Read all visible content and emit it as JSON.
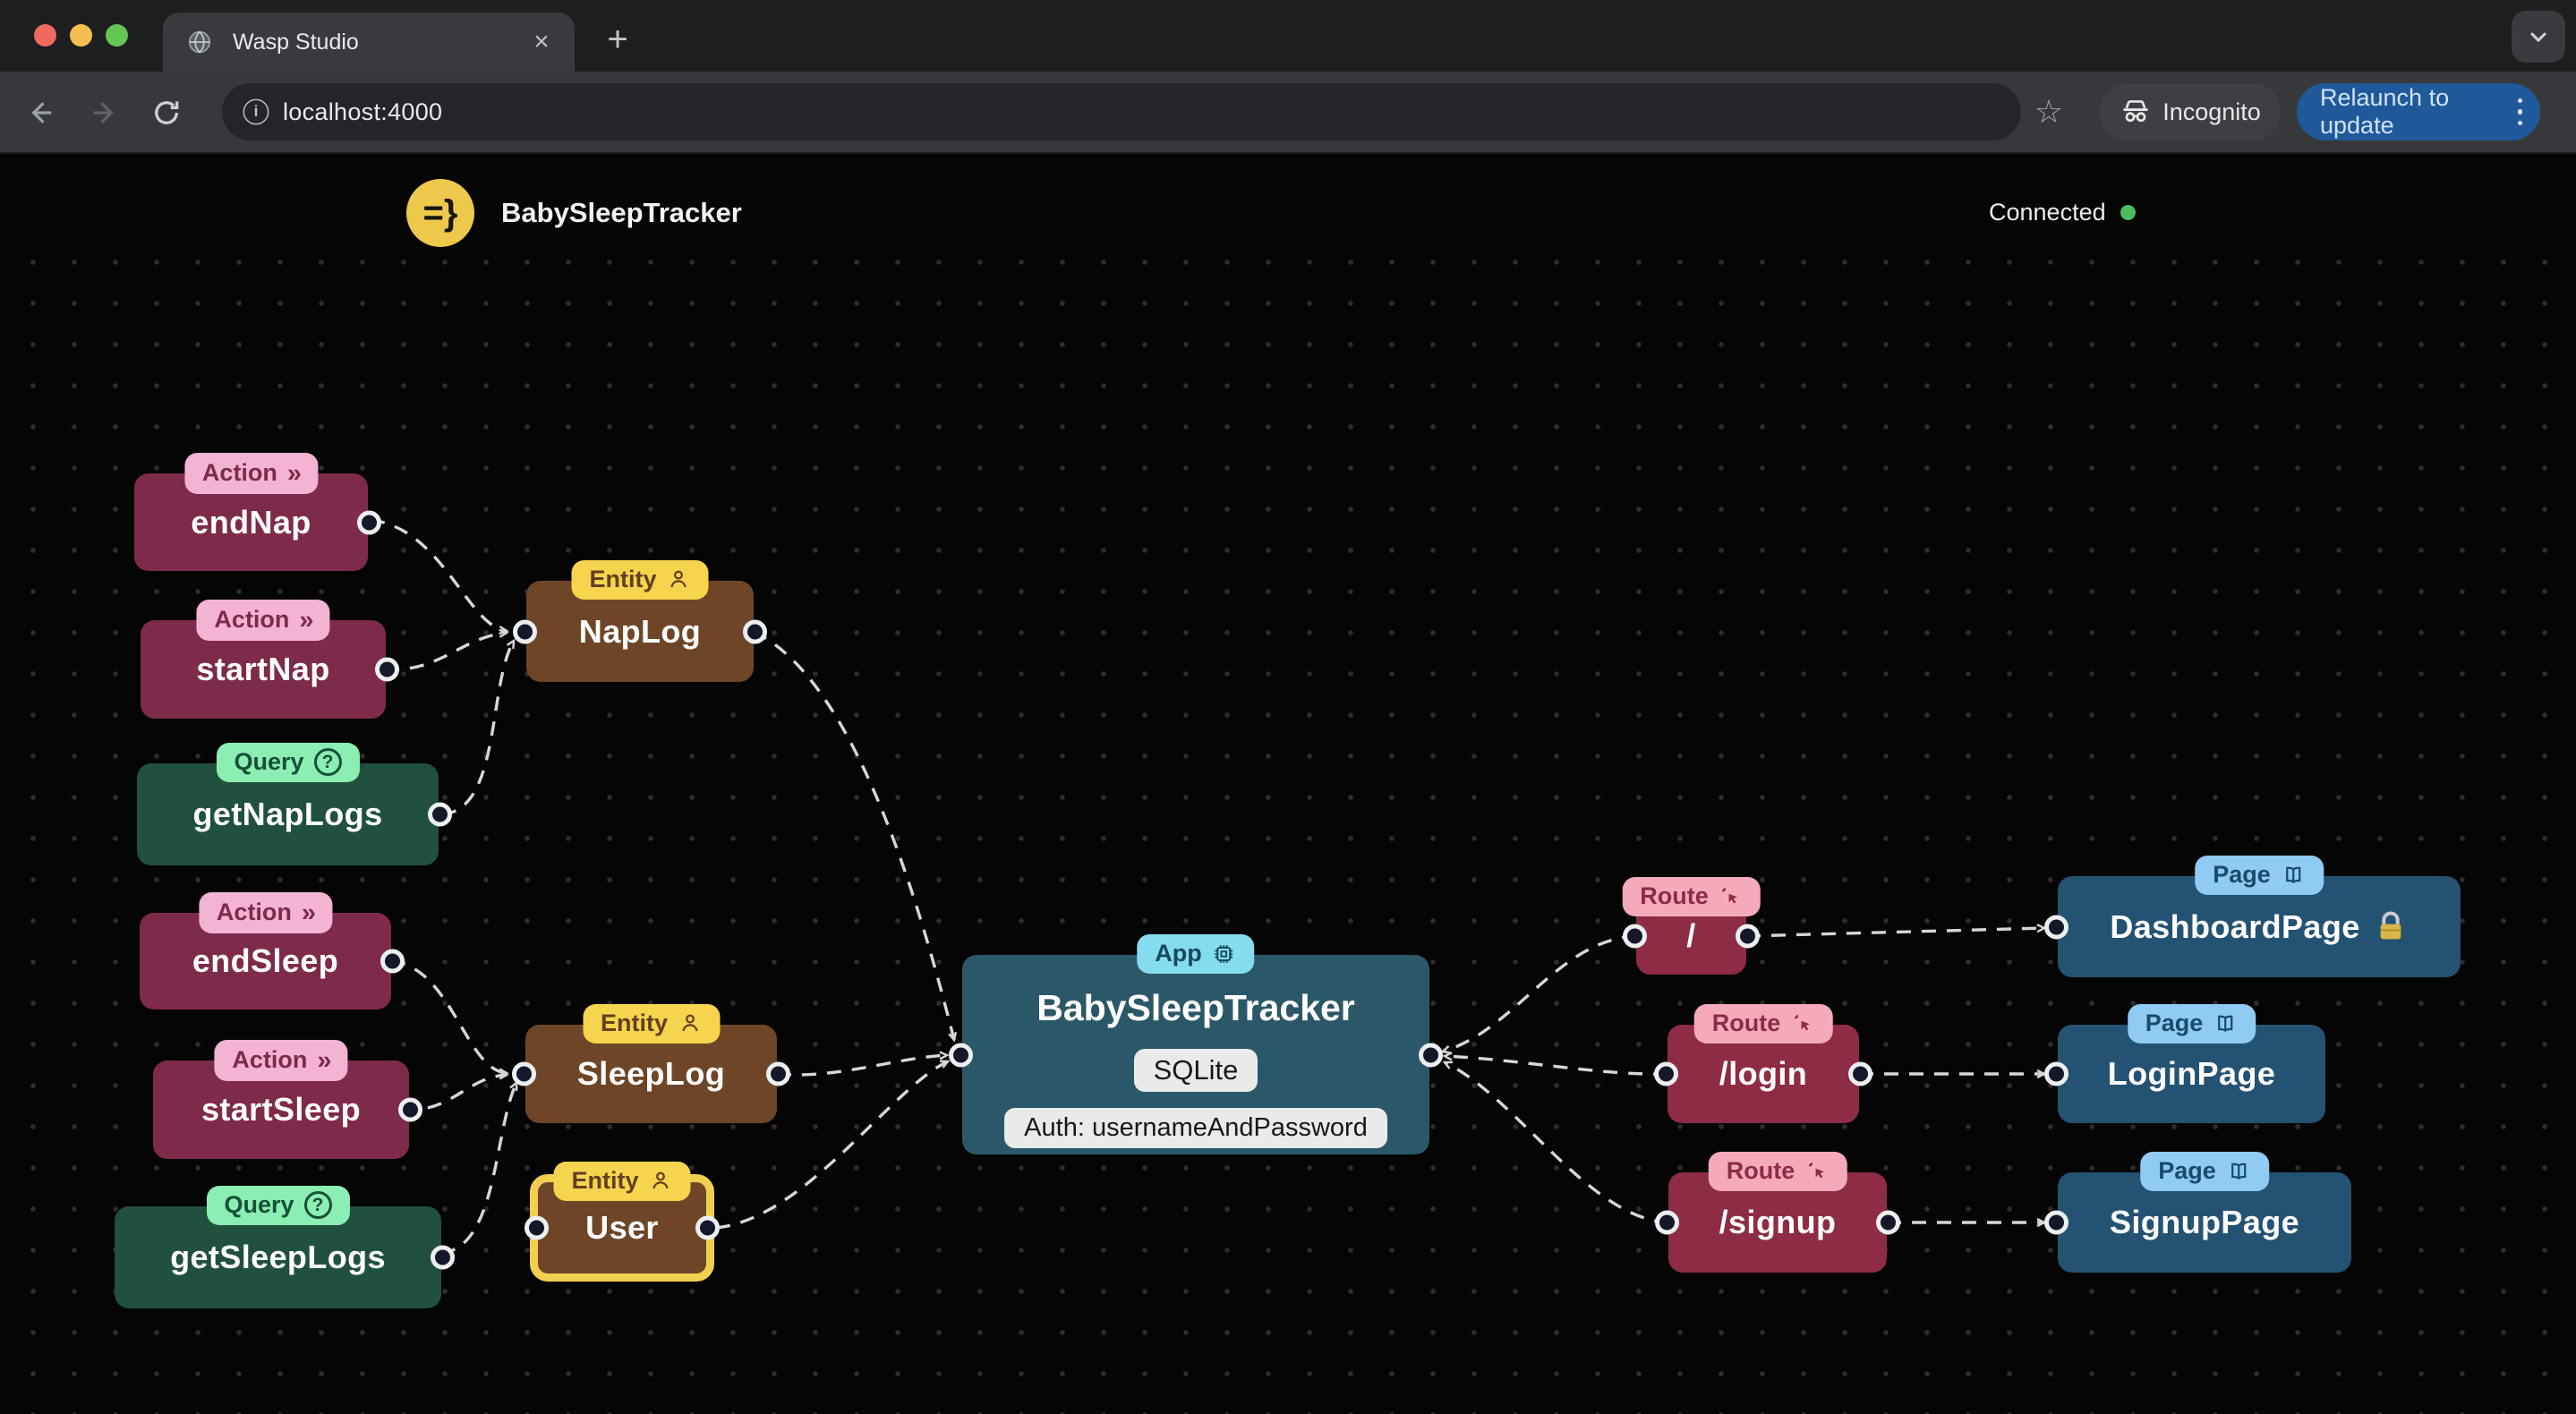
{
  "browser": {
    "tab_title": "Wasp Studio",
    "url": "localhost:4000",
    "incognito_label": "Incognito",
    "relaunch_label": "Relaunch to update"
  },
  "header": {
    "app_title": "BabySleepTracker",
    "status_label": "Connected",
    "logo_glyph": "=}"
  },
  "badges": {
    "action": "Action",
    "query": "Query",
    "entity": "Entity",
    "app": "App",
    "route": "Route",
    "page": "Page"
  },
  "icons": {
    "action_chevrons": "»",
    "query_question": "?",
    "new_tab": "+",
    "close_tab": "×",
    "bookmark_star": "☆",
    "url_info": "i"
  },
  "nodes": {
    "endNap": {
      "label": "endNap"
    },
    "startNap": {
      "label": "startNap"
    },
    "getNapLogs": {
      "label": "getNapLogs"
    },
    "endSleep": {
      "label": "endSleep"
    },
    "startSleep": {
      "label": "startSleep"
    },
    "getSleepLogs": {
      "label": "getSleepLogs"
    },
    "napLog": {
      "label": "NapLog"
    },
    "sleepLog": {
      "label": "SleepLog"
    },
    "user": {
      "label": "User"
    },
    "app": {
      "label": "BabySleepTracker",
      "db_label": "SQLite",
      "auth_label": "Auth: usernameAndPassword"
    },
    "routeRoot": {
      "label": "/"
    },
    "routeLogin": {
      "label": "/login"
    },
    "routeSignup": {
      "label": "/signup"
    },
    "dashboardPage": {
      "label": "DashboardPage",
      "auth_required": true
    },
    "loginPage": {
      "label": "LoginPage"
    },
    "signupPage": {
      "label": "SignupPage"
    }
  },
  "colors": {
    "action_body": "#7e2a4b",
    "action_badge": "#f3b3d2",
    "query_body": "#20503e",
    "query_badge": "#8beeb2",
    "entity_body": "#6e4627",
    "entity_badge": "#f6d44d",
    "route_body": "#8e2b45",
    "route_badge": "#f4aaba",
    "app_body": "#2b5868",
    "app_badge": "#85dcef",
    "page_body": "#245273",
    "page_badge": "#8fcbf2",
    "selection_border": "#f2cf50",
    "status_connected": "#4cbb5f",
    "edge": "#d5d7d9",
    "relaunch_button": "#20599a"
  }
}
